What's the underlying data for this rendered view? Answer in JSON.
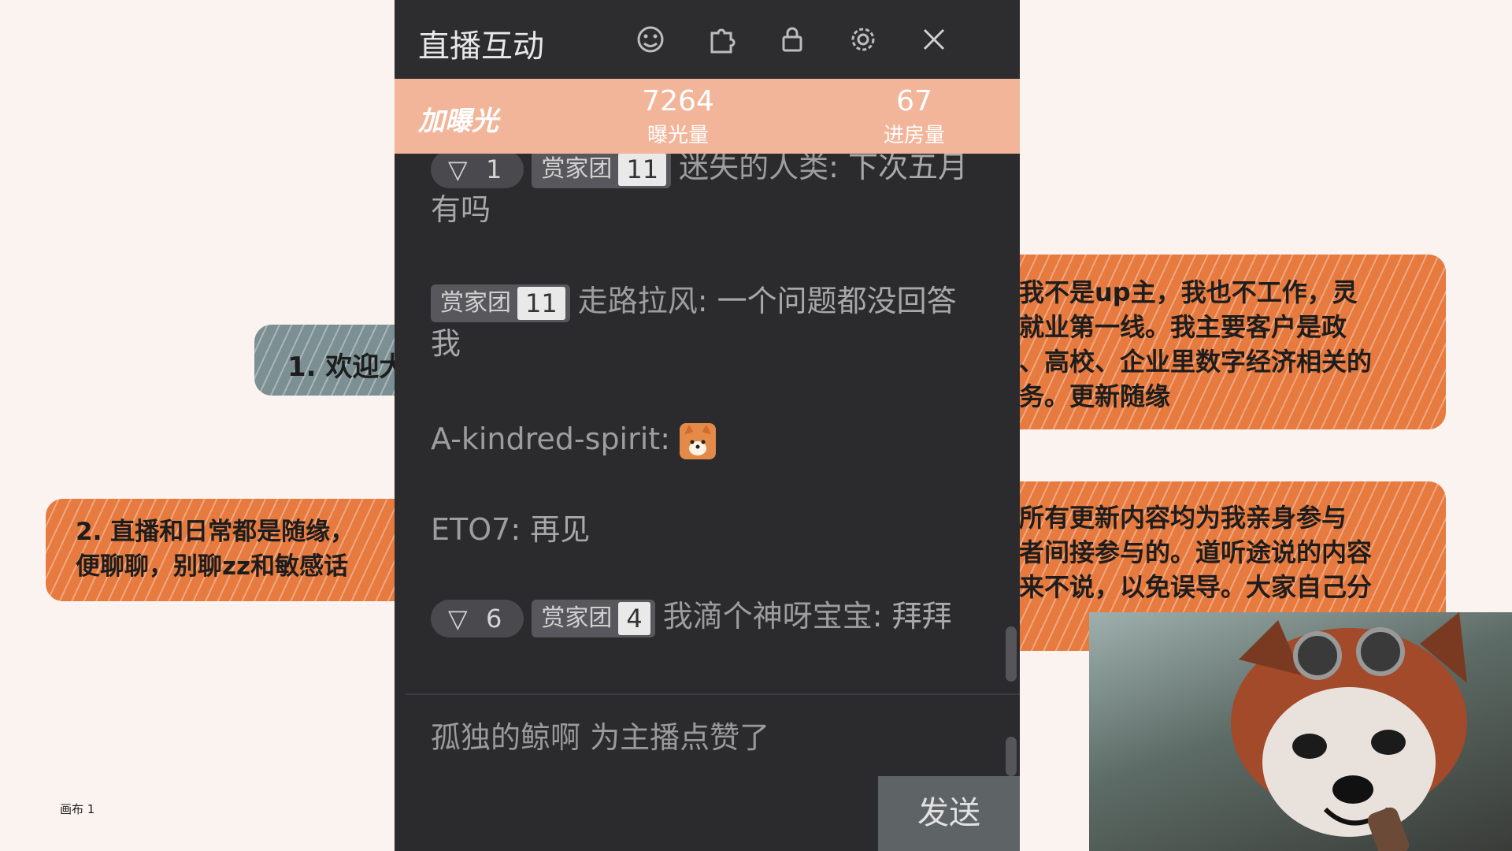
{
  "background": {
    "note1": "1. 欢迎大",
    "note2_lines": "2. 直播和日常都是随缘，\n便聊聊，别聊zz和敏感话",
    "note3_lines": "我不是up主，我也不工作，灵\n就业第一线。我主要客户是政\n、高校、企业里数字经济相关的\n务。更新随缘",
    "note4_lines": "所有更新内容均为我亲身参与\n者间接参与的。道听途说的内容\n来不说，以免误导。大家自己分",
    "canvas_label": "画布 1"
  },
  "panel": {
    "title": "直播互动",
    "header_icons": [
      "emoji-icon",
      "puzzle-icon",
      "lock-icon",
      "gear-icon",
      "close-icon"
    ],
    "boost_label": "加曝光",
    "exposure_value": "7264",
    "exposure_label": "曝光量",
    "rooms_value": "67",
    "rooms_label": "进房量",
    "messages": [
      {
        "level": "1",
        "fan_club": "赏家团",
        "fan_level": "11",
        "user": "迷失的人类",
        "text": "下次五月有吗"
      },
      {
        "fan_club": "赏家团",
        "fan_level": "11",
        "user": "走路拉风",
        "text": "一个问题都没回答我"
      },
      {
        "user": "A-kindred-spirit",
        "text": ""
      },
      {
        "user": "ETO7",
        "text": "再见"
      },
      {
        "level": "6",
        "fan_club": "赏家团",
        "fan_level": "4",
        "user": "我滴个神呀宝宝",
        "text": "拜拜"
      }
    ],
    "like_notice": "孤独的鲸啊 为主播点赞了",
    "send_label": "发送"
  }
}
